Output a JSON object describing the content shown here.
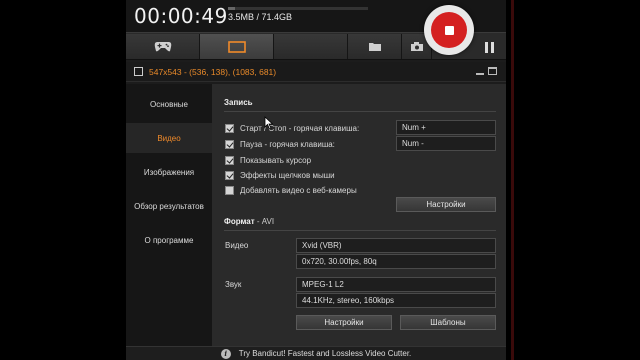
{
  "topbar": {
    "timer": "00:00:49",
    "size": "3.5MB / 71.4GB",
    "size_fraction": 0.05
  },
  "modes": [
    {
      "name": "game",
      "icon": "gamepad-icon",
      "active": false
    },
    {
      "name": "screen",
      "icon": "screen-rectangle-icon",
      "active": true
    },
    {
      "name": "device",
      "icon": "blank",
      "active": false
    },
    {
      "name": "folder",
      "icon": "folder-icon",
      "active": false
    },
    {
      "name": "camera",
      "icon": "camera-icon",
      "active": false
    }
  ],
  "area": {
    "text": "547x543 - (536, 138), (1083, 681)"
  },
  "sidebar": {
    "items": [
      {
        "label": "Основные",
        "active": false
      },
      {
        "label": "Видео",
        "active": true
      },
      {
        "label": "Изображения",
        "active": false
      },
      {
        "label": "Обзор результатов",
        "active": false
      },
      {
        "label": "О программе",
        "active": false
      }
    ]
  },
  "record": {
    "title": "Запись",
    "options": [
      {
        "label": "Старт / Стоп - горячая клавиша:",
        "checked": true
      },
      {
        "label": "Пауза - горячая клавиша:",
        "checked": true
      },
      {
        "label": "Показывать курсор",
        "checked": true
      },
      {
        "label": "Эффекты щелчков мыши",
        "checked": true
      },
      {
        "label": "Добавлять видео с веб-камеры",
        "checked": false
      }
    ],
    "hotkey_start": "Num +",
    "hotkey_pause": "Num -",
    "settings_btn": "Настройки"
  },
  "format": {
    "title": "Формат",
    "title_sep": " - ",
    "container": "AVI",
    "video_label": "Видео",
    "video_codec": "Xvid (VBR)",
    "video_params": "0x720, 30.00fps, 80q",
    "audio_label": "Звук",
    "audio_codec": "MPEG-1 L2",
    "audio_params": "44.1KHz, stereo, 160kbps",
    "settings_btn": "Настройки",
    "templates_btn": "Шаблоны"
  },
  "footer": {
    "text": "Try Bandicut! Fastest and Lossless Video Cutter."
  },
  "colors": {
    "accent": "#f08a2a",
    "record": "#d42020"
  }
}
